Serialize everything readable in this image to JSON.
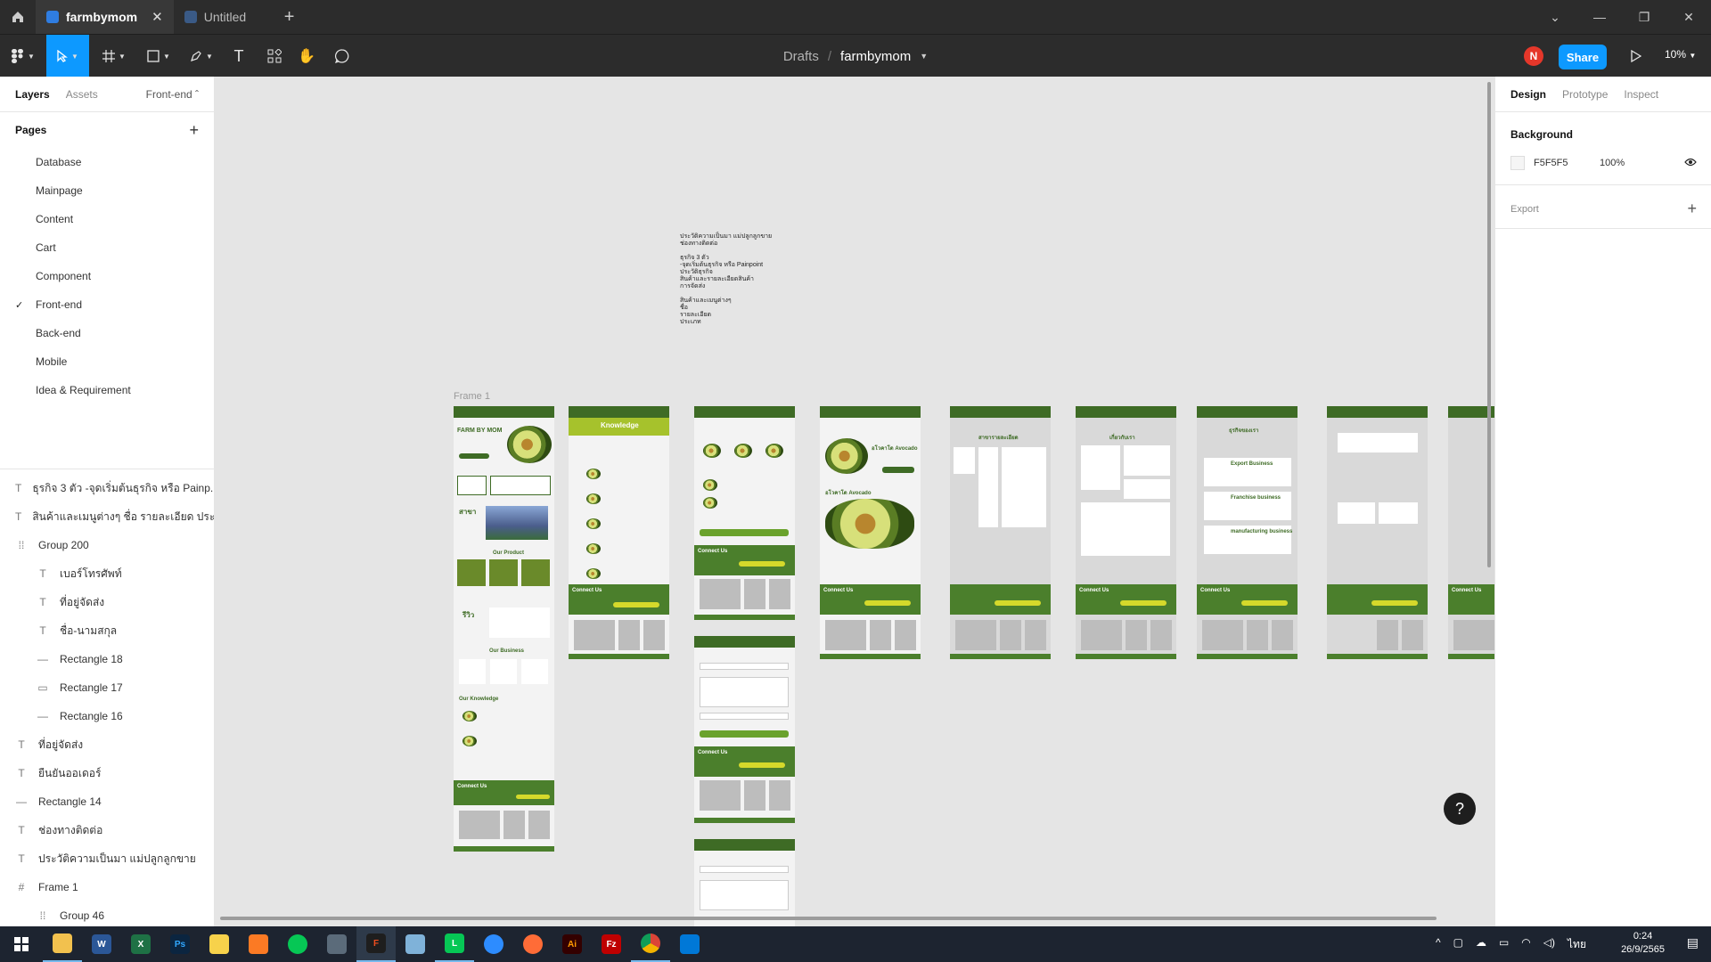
{
  "titlebar": {
    "tabs": [
      {
        "label": "farmbymom",
        "active": true
      },
      {
        "label": "Untitled",
        "active": false
      }
    ]
  },
  "toolbar": {
    "breadcrumb_root": "Drafts",
    "breadcrumb_sep": "/",
    "file_name": "farmbymom",
    "avatar_initial": "N",
    "share_label": "Share",
    "zoom": "10%"
  },
  "left_panel": {
    "tabs": {
      "layers": "Layers",
      "assets": "Assets",
      "page_selector": "Front-end ˆ"
    },
    "pages_title": "Pages",
    "pages": [
      "Database",
      "Mainpage",
      "Content",
      "Cart",
      "Component",
      "Front-end",
      "Back-end",
      "Mobile",
      "Idea & Requirement"
    ],
    "current_page": "Front-end",
    "layers": [
      {
        "type": "text",
        "label": "ธุรกิจ 3 ตัว -จุดเริ่มต้นธุรกิจ หรือ Painp..."
      },
      {
        "type": "text",
        "label": "สินค้าและเมนูต่างๆ ชื่อ รายละเอียด ประเ..."
      },
      {
        "type": "group",
        "label": "Group 200"
      },
      {
        "type": "text",
        "label": "เบอร์โทรศัพท์"
      },
      {
        "type": "text",
        "label": "ที่อยู่จัดส่ง"
      },
      {
        "type": "text",
        "label": "ชื่อ-นามสกุล"
      },
      {
        "type": "line",
        "label": "Rectangle 18"
      },
      {
        "type": "rect",
        "label": "Rectangle 17"
      },
      {
        "type": "line",
        "label": "Rectangle 16"
      },
      {
        "type": "text",
        "label": "ที่อยู่จัดส่ง"
      },
      {
        "type": "text",
        "label": "ยืนยันออเดอร์"
      },
      {
        "type": "line",
        "label": "Rectangle 14"
      },
      {
        "type": "text",
        "label": "ช่องทางติดต่อ"
      },
      {
        "type": "text",
        "label": "ประวัติความเป็นมา แม่ปลูกลูกขาย"
      },
      {
        "type": "frame",
        "label": "Frame 1"
      },
      {
        "type": "group",
        "label": "Group 46"
      }
    ]
  },
  "canvas": {
    "note_lines": [
      "ประวัติความเป็นมา แม่ปลูกลูกขาย",
      "ช่องทางติดต่อ",
      "",
      "ธุรกิจ 3 ตัว",
      "-จุดเริ่มต้นธุรกิจ หรือ Painpoint",
      "ประวัติธุรกิจ",
      "สินค้าและรายละเอียดสินค้า",
      "การจัดส่ง",
      "",
      "สินค้าและเมนูต่างๆ",
      "ชื่อ",
      "รายละเอียด",
      "ประเภท"
    ],
    "frame_label": "Frame 1",
    "mock_texts": {
      "farm": "FARM BY MOM",
      "knowledge": "Knowledge",
      "connect": "Connect Us",
      "branch": "สาขา",
      "review": "รีวิว",
      "our_product": "Our Product",
      "our_business": "Our Business",
      "our_knowledge": "Our Knowledge",
      "avocado": "อโวคาโด Avocado",
      "branch_detail": "สาขารายละเอียด",
      "about": "เกี่ยวกับเรา",
      "our_biz_th": "ธุรกิจของเรา",
      "export": "Export Business",
      "franchise": "Franchise business",
      "manufacturing": "manufacturing business"
    }
  },
  "right_panel": {
    "tabs": {
      "design": "Design",
      "prototype": "Prototype",
      "inspect": "Inspect"
    },
    "background_title": "Background",
    "background_hex": "F5F5F5",
    "background_opacity": "100%",
    "export_title": "Export"
  },
  "taskbar": {
    "time": "0:24",
    "date": "26/9/2565",
    "lang": "ไทย",
    "apps": [
      "explorer",
      "word",
      "excel",
      "photoshop",
      "sticky-notes",
      "xampp",
      "line-chat",
      "calculator",
      "figma",
      "notepad",
      "line",
      "zoom",
      "postman",
      "illustrator",
      "filezilla",
      "chrome",
      "vscode"
    ]
  },
  "colors": {
    "accent": "#0d99ff",
    "brand_green": "#3e6b25",
    "canvas_bg": "#e5e5e5"
  }
}
